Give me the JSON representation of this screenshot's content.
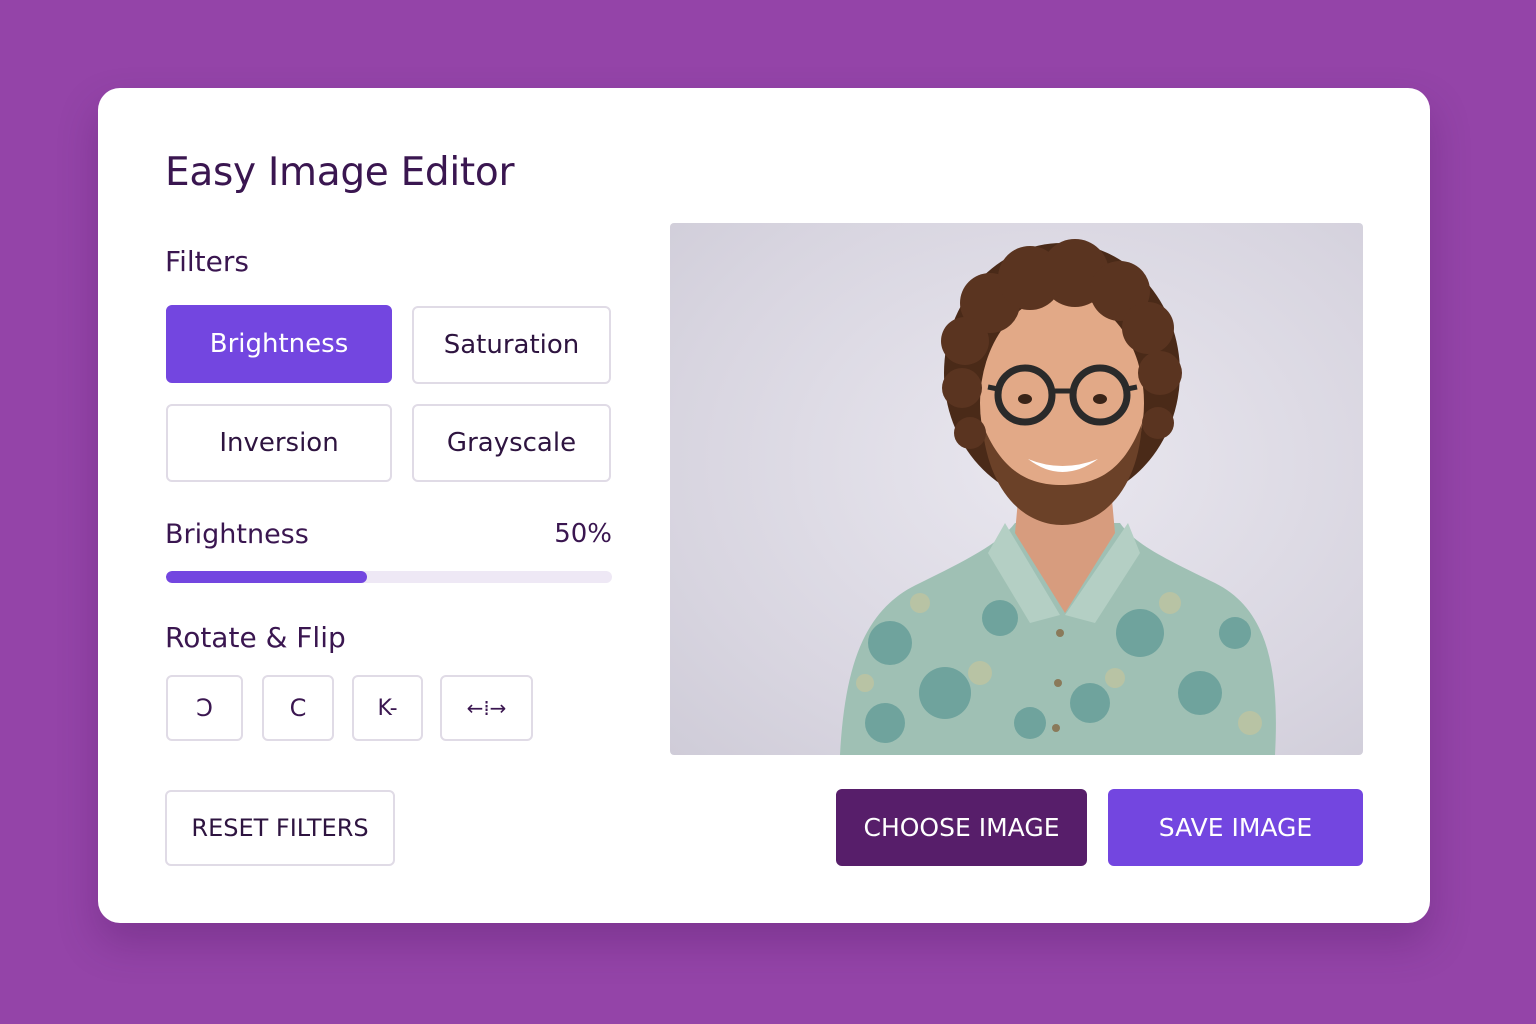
{
  "app": {
    "title": "Easy Image Editor"
  },
  "filters": {
    "label": "Filters",
    "buttons": [
      {
        "label": "Brightness",
        "active": true
      },
      {
        "label": "Saturation",
        "active": false
      },
      {
        "label": "Inversion",
        "active": false
      },
      {
        "label": "Grayscale",
        "active": false
      }
    ]
  },
  "slider": {
    "label": "Brightness",
    "value_text": "50%",
    "fill_fraction": 0.45
  },
  "rotate": {
    "label": "Rotate & Flip",
    "buttons": [
      {
        "icon": "rotate-left-icon",
        "glyph": "Ↄ"
      },
      {
        "icon": "rotate-right-icon",
        "glyph": "C"
      },
      {
        "icon": "flip-horizontal-icon",
        "glyph": "K-"
      },
      {
        "icon": "flip-vertical-icon",
        "glyph": "←⁞→"
      }
    ]
  },
  "actions": {
    "reset_label": "RESET FILTERS",
    "choose_label": "CHOOSE IMAGE",
    "save_label": "SAVE IMAGE"
  },
  "colors": {
    "background": "#9444a8",
    "accent": "#7346e0",
    "choose_button": "#571e6a",
    "text": "#3a1650"
  }
}
